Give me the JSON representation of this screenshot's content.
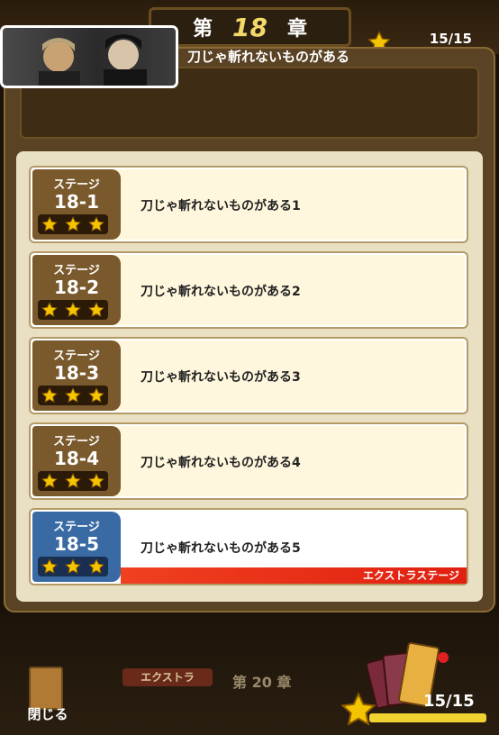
{
  "header": {
    "chapter_prefix": "第",
    "chapter_num": "18",
    "chapter_suffix": "章",
    "star_count": "15/15"
  },
  "chapter_title": "刀じゃ斬れないものがある",
  "stages": [
    {
      "label": "ステージ",
      "num": "18-1",
      "name": "刀じゃ斬れないものがある1"
    },
    {
      "label": "ステージ",
      "num": "18-2",
      "name": "刀じゃ斬れないものがある2"
    },
    {
      "label": "ステージ",
      "num": "18-3",
      "name": "刀じゃ斬れないものがある3"
    },
    {
      "label": "ステージ",
      "num": "18-4",
      "name": "刀じゃ斬れないものがある4"
    },
    {
      "label": "ステージ",
      "num": "18-5",
      "name": "刀じゃ斬れないものがある5",
      "tag": "エクストラステージ"
    }
  ],
  "footer": {
    "close_label": "閉じる",
    "extra_tab": "エクストラ",
    "next_chapter": "第 20 章",
    "star_count": "15/15"
  },
  "colors": {
    "star": "#f5c400",
    "extra_strip": "#e02010",
    "badge_normal": "#7a5a2c",
    "badge_extra": "#3a6aa4"
  }
}
